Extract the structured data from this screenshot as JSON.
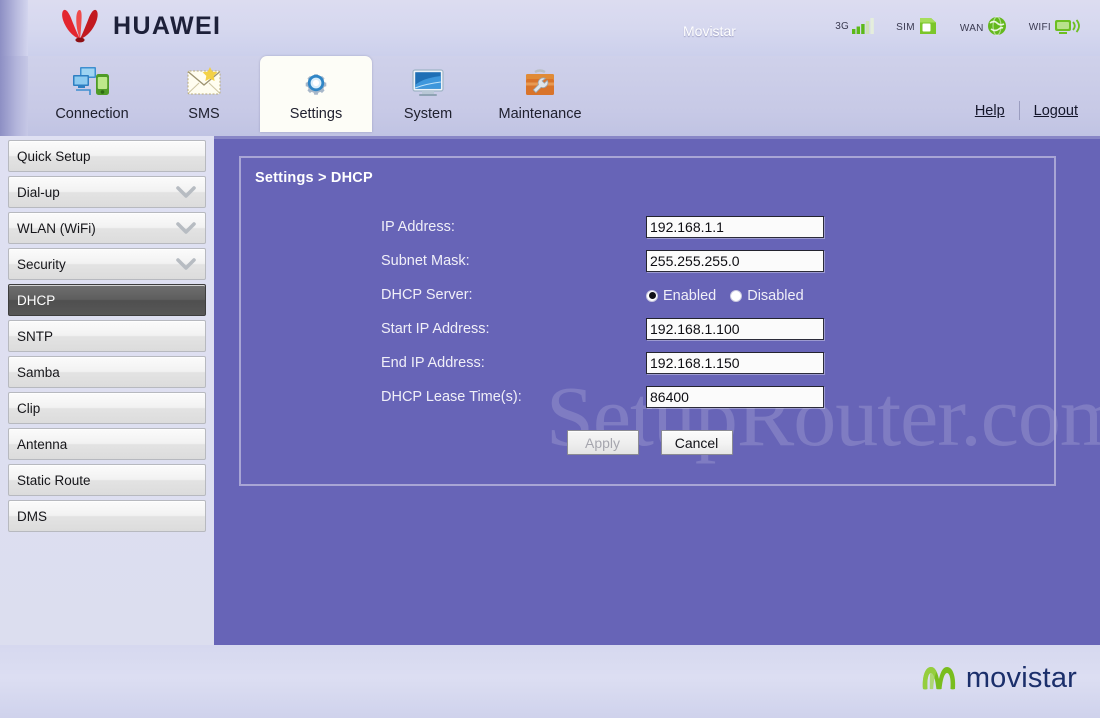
{
  "brand": {
    "vendor": "HUAWEI",
    "carrier": "Movistar",
    "status_icons": [
      {
        "label": "3G",
        "icon": "signal-bars-icon"
      },
      {
        "label": "SIM",
        "icon": "sim-card-icon"
      },
      {
        "label": "WAN",
        "icon": "globe-icon"
      },
      {
        "label": "WIFI",
        "icon": "wifi-icon"
      }
    ]
  },
  "nav": {
    "tabs": [
      {
        "label": "Connection",
        "icon": "connection-icon",
        "active": false
      },
      {
        "label": "SMS",
        "icon": "envelope-icon",
        "active": false
      },
      {
        "label": "Settings",
        "icon": "gear-icon",
        "active": true
      },
      {
        "label": "System",
        "icon": "monitor-icon",
        "active": false
      },
      {
        "label": "Maintenance",
        "icon": "toolbox-icon",
        "active": false
      }
    ],
    "help_label": "Help",
    "logout_label": "Logout"
  },
  "sidebar": {
    "items": [
      {
        "label": "Quick Setup",
        "expandable": false,
        "selected": false
      },
      {
        "label": "Dial-up",
        "expandable": true,
        "selected": false
      },
      {
        "label": "WLAN (WiFi)",
        "expandable": true,
        "selected": false
      },
      {
        "label": "Security",
        "expandable": true,
        "selected": false
      },
      {
        "label": "DHCP",
        "expandable": false,
        "selected": true
      },
      {
        "label": "SNTP",
        "expandable": false,
        "selected": false
      },
      {
        "label": "Samba",
        "expandable": false,
        "selected": false
      },
      {
        "label": "Clip",
        "expandable": false,
        "selected": false
      },
      {
        "label": "Antenna",
        "expandable": false,
        "selected": false
      },
      {
        "label": "Static Route",
        "expandable": false,
        "selected": false
      },
      {
        "label": "DMS",
        "expandable": false,
        "selected": false
      }
    ]
  },
  "main": {
    "breadcrumb": "Settings > DHCP",
    "watermark": "SetupRouter.com",
    "fields": {
      "ip_address": {
        "label": "IP Address:",
        "value": "192.168.1.1"
      },
      "subnet_mask": {
        "label": "Subnet Mask:",
        "value": "255.255.255.0"
      },
      "dhcp_server": {
        "label": "DHCP Server:",
        "options": [
          {
            "label": "Enabled",
            "selected": true
          },
          {
            "label": "Disabled",
            "selected": false
          }
        ]
      },
      "start_ip": {
        "label": "Start IP Address:",
        "value": "192.168.1.100"
      },
      "end_ip": {
        "label": "End IP Address:",
        "value": "192.168.1.150"
      },
      "lease_time": {
        "label": "DHCP Lease Time(s):",
        "value": "86400"
      }
    },
    "buttons": {
      "apply": "Apply",
      "cancel": "Cancel"
    }
  },
  "footer": {
    "logo_text": "movistar"
  },
  "colors": {
    "panel_purple": "#6764b7",
    "panel_border": "#a8a5d5",
    "selected_menu": "#5e5e5e",
    "movistar_green": "#7fc41d",
    "movistar_navy": "#1b2f6b",
    "huawei_red": "#d5232d"
  }
}
